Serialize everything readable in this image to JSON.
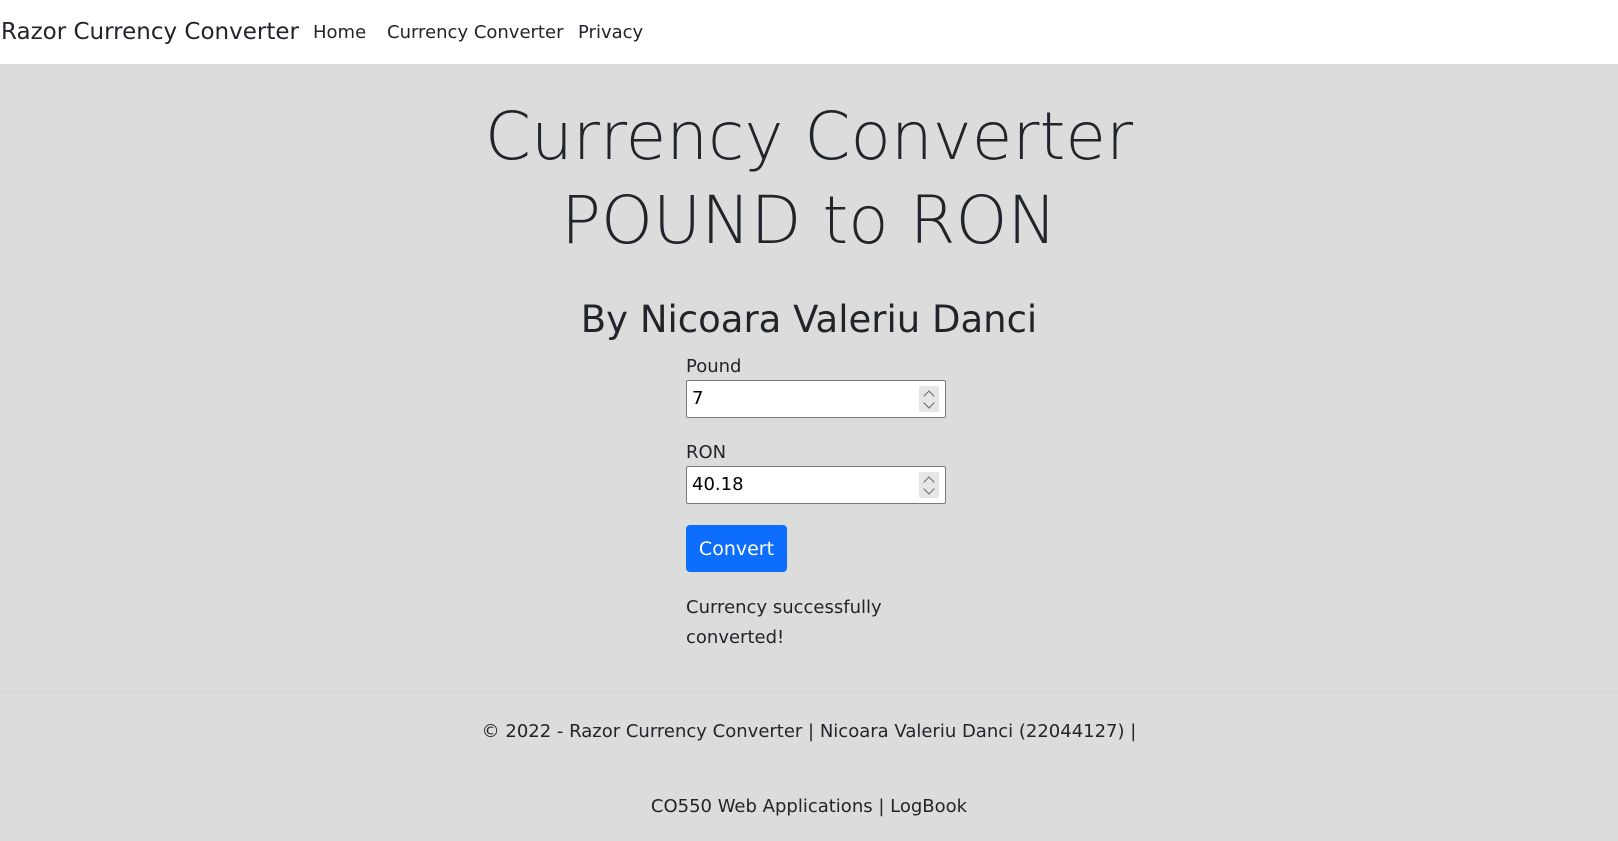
{
  "navbar": {
    "brand": "Razor Currency Converter",
    "links": [
      "Home",
      "Currency Converter",
      "Privacy"
    ]
  },
  "main": {
    "title_line1": "Currency Converter",
    "title_line2": "POUND to RON",
    "subtitle": "By Nicoara Valeriu Danci",
    "form": {
      "pound_label": "Pound",
      "pound_value": "7",
      "ron_label": "RON",
      "ron_value": "40.18",
      "convert_label": "Convert",
      "status_line1": "Currency successfully",
      "status_line2": "converted!"
    }
  },
  "footer": {
    "copyright": "© 2022 - Razor Currency Converter | Nicoara Valeriu Danci (22044127) |",
    "course": "CO550 Web Applications",
    "separator": "|",
    "logbook": "LogBook"
  },
  "colors": {
    "primary": "#0d6efd",
    "background": "#dcdcdc",
    "navbar": "#ffffff",
    "text": "#212529"
  }
}
